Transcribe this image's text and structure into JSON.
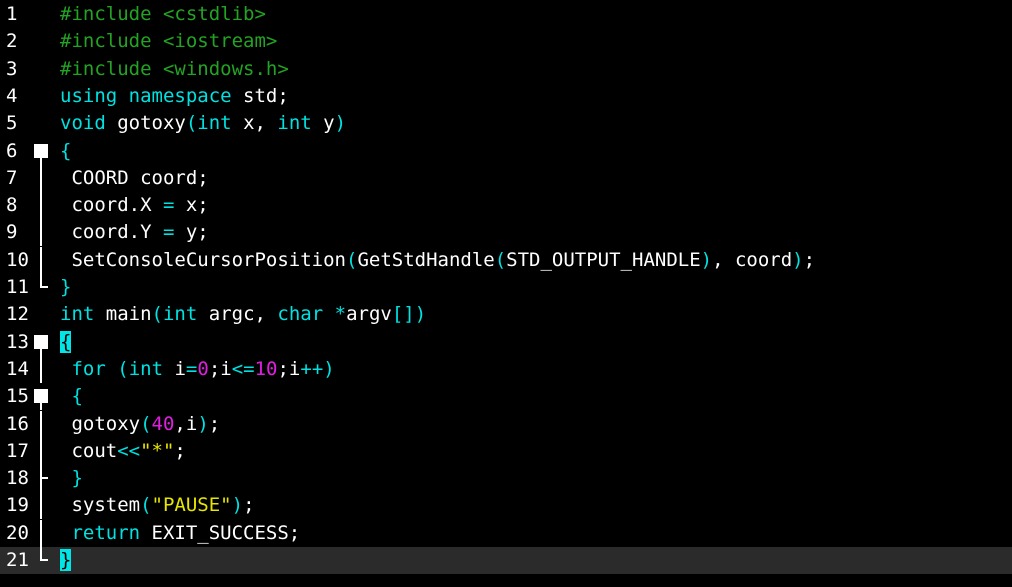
{
  "colors": {
    "background": "#000000",
    "current_line": "#2b2b2b",
    "preprocessor": "#23a323",
    "keyword": "#00e1e1",
    "number": "#e01ee0",
    "string": "#e6e600",
    "text": "#ffffff",
    "bracket_match": "#00e5e5"
  },
  "current_line": 21,
  "lines": [
    {
      "n": "1",
      "fold": "none",
      "tokens": [
        {
          "t": "#include <cstdlib>",
          "c": "preprocessor"
        }
      ]
    },
    {
      "n": "2",
      "fold": "none",
      "tokens": [
        {
          "t": "#include <iostream>",
          "c": "preprocessor"
        }
      ]
    },
    {
      "n": "3",
      "fold": "none",
      "tokens": [
        {
          "t": "#include <windows.h>",
          "c": "preprocessor"
        }
      ]
    },
    {
      "n": "4",
      "fold": "none",
      "tokens": [
        {
          "t": "using",
          "c": "keyword"
        },
        {
          "t": " ",
          "c": "text"
        },
        {
          "t": "namespace",
          "c": "keyword"
        },
        {
          "t": " std;",
          "c": "text"
        }
      ]
    },
    {
      "n": "5",
      "fold": "none",
      "tokens": [
        {
          "t": "void",
          "c": "keyword"
        },
        {
          "t": " gotoxy",
          "c": "text"
        },
        {
          "t": "(",
          "c": "keyword"
        },
        {
          "t": "int",
          "c": "keyword"
        },
        {
          "t": " x, ",
          "c": "text"
        },
        {
          "t": "int",
          "c": "keyword"
        },
        {
          "t": " y",
          "c": "text"
        },
        {
          "t": ")",
          "c": "keyword"
        }
      ]
    },
    {
      "n": "6",
      "fold": "start",
      "tokens": [
        {
          "t": "{",
          "c": "keyword"
        }
      ]
    },
    {
      "n": "7",
      "fold": "line",
      "tokens": [
        {
          "t": " COORD coord;",
          "c": "text"
        }
      ]
    },
    {
      "n": "8",
      "fold": "line",
      "tokens": [
        {
          "t": " coord.X ",
          "c": "text"
        },
        {
          "t": "=",
          "c": "keyword"
        },
        {
          "t": " x;",
          "c": "text"
        }
      ]
    },
    {
      "n": "9",
      "fold": "line",
      "tokens": [
        {
          "t": " coord.Y ",
          "c": "text"
        },
        {
          "t": "=",
          "c": "keyword"
        },
        {
          "t": " y;",
          "c": "text"
        }
      ]
    },
    {
      "n": "10",
      "fold": "line",
      "tokens": [
        {
          "t": " SetConsoleCursorPosition",
          "c": "text"
        },
        {
          "t": "(",
          "c": "keyword"
        },
        {
          "t": "GetStdHandle",
          "c": "text"
        },
        {
          "t": "(",
          "c": "keyword"
        },
        {
          "t": "STD_OUTPUT_HANDLE",
          "c": "text"
        },
        {
          "t": ")",
          "c": "keyword"
        },
        {
          "t": ", coord",
          "c": "text"
        },
        {
          "t": ")",
          "c": "keyword"
        },
        {
          "t": ";",
          "c": "text"
        }
      ]
    },
    {
      "n": "11",
      "fold": "end",
      "tokens": [
        {
          "t": "}",
          "c": "keyword"
        }
      ]
    },
    {
      "n": "12",
      "fold": "none",
      "tokens": [
        {
          "t": "int",
          "c": "keyword"
        },
        {
          "t": " main",
          "c": "text"
        },
        {
          "t": "(",
          "c": "keyword"
        },
        {
          "t": "int",
          "c": "keyword"
        },
        {
          "t": " argc, ",
          "c": "text"
        },
        {
          "t": "char",
          "c": "keyword"
        },
        {
          "t": " ",
          "c": "text"
        },
        {
          "t": "*",
          "c": "keyword"
        },
        {
          "t": "argv",
          "c": "text"
        },
        {
          "t": "[])",
          "c": "keyword"
        }
      ]
    },
    {
      "n": "13",
      "fold": "start",
      "tokens": [
        {
          "t": "{",
          "c": "keyword",
          "hl": true
        }
      ]
    },
    {
      "n": "14",
      "fold": "line",
      "tokens": [
        {
          "t": " ",
          "c": "text"
        },
        {
          "t": "for",
          "c": "keyword"
        },
        {
          "t": " ",
          "c": "text"
        },
        {
          "t": "(",
          "c": "keyword"
        },
        {
          "t": "int",
          "c": "keyword"
        },
        {
          "t": " i",
          "c": "text"
        },
        {
          "t": "=",
          "c": "keyword"
        },
        {
          "t": "0",
          "c": "number"
        },
        {
          "t": ";i",
          "c": "text"
        },
        {
          "t": "<=",
          "c": "keyword"
        },
        {
          "t": "10",
          "c": "number"
        },
        {
          "t": ";i",
          "c": "text"
        },
        {
          "t": "++)",
          "c": "keyword"
        }
      ]
    },
    {
      "n": "15",
      "fold": "start",
      "tokens": [
        {
          "t": " ",
          "c": "text"
        },
        {
          "t": "{",
          "c": "keyword"
        }
      ]
    },
    {
      "n": "16",
      "fold": "line",
      "tokens": [
        {
          "t": " gotoxy",
          "c": "text"
        },
        {
          "t": "(",
          "c": "keyword"
        },
        {
          "t": "40",
          "c": "number"
        },
        {
          "t": ",i",
          "c": "text"
        },
        {
          "t": ")",
          "c": "keyword"
        },
        {
          "t": ";",
          "c": "text"
        }
      ]
    },
    {
      "n": "17",
      "fold": "line",
      "tokens": [
        {
          "t": " cout",
          "c": "text"
        },
        {
          "t": "<<",
          "c": "keyword"
        },
        {
          "t": "\"*\"",
          "c": "string"
        },
        {
          "t": ";",
          "c": "text"
        }
      ]
    },
    {
      "n": "18",
      "fold": "end-inner",
      "tokens": [
        {
          "t": " ",
          "c": "text"
        },
        {
          "t": "}",
          "c": "keyword"
        }
      ]
    },
    {
      "n": "19",
      "fold": "line",
      "tokens": [
        {
          "t": " system",
          "c": "text"
        },
        {
          "t": "(",
          "c": "keyword"
        },
        {
          "t": "\"PAUSE\"",
          "c": "string"
        },
        {
          "t": ")",
          "c": "keyword"
        },
        {
          "t": ";",
          "c": "text"
        }
      ]
    },
    {
      "n": "20",
      "fold": "line",
      "tokens": [
        {
          "t": " ",
          "c": "text"
        },
        {
          "t": "return",
          "c": "keyword"
        },
        {
          "t": " EXIT_SUCCESS;",
          "c": "text"
        }
      ]
    },
    {
      "n": "21",
      "fold": "end",
      "tokens": [
        {
          "t": "}",
          "c": "keyword",
          "hl": true
        }
      ]
    }
  ]
}
